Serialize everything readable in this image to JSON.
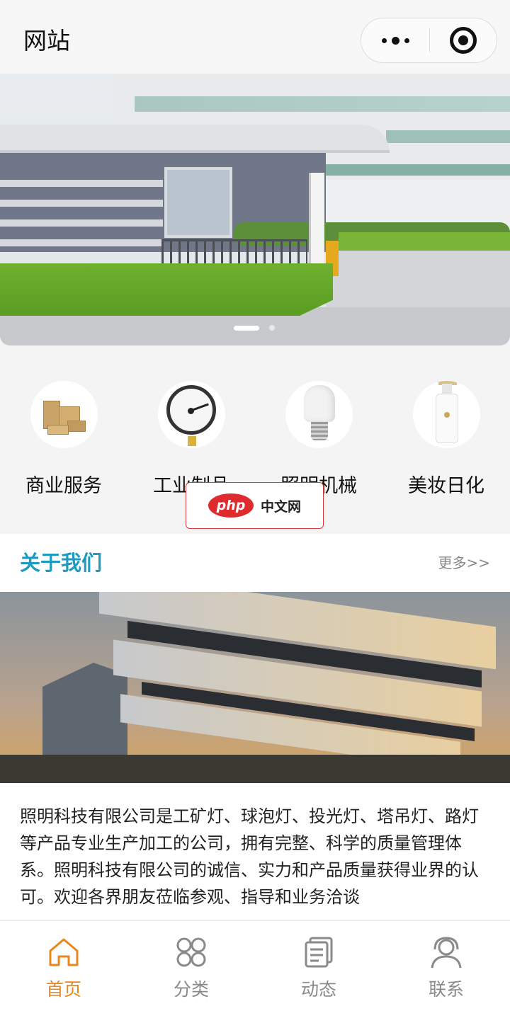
{
  "navbar": {
    "title": "网站"
  },
  "banner": {
    "slides": 2,
    "active_slide": 1
  },
  "categories": [
    {
      "label": "商业服务",
      "icon": "cardboard-boxes-icon"
    },
    {
      "label": "工业制品",
      "icon": "pressure-gauge-icon"
    },
    {
      "label": "照明机械",
      "icon": "light-bulb-icon"
    },
    {
      "label": "美妆日化",
      "icon": "lotion-bottle-icon"
    }
  ],
  "watermark": {
    "logo": "php",
    "text": "中文网"
  },
  "about": {
    "title": "关于我们",
    "more": "更多>>",
    "text": "照明科技有限公司是工矿灯、球泡灯、投光灯、塔吊灯、路灯等产品专业生产加工的公司，拥有完整、科学的质量管理体系。照明科技有限公司的诚信、实力和产品质量获得业界的认可。欢迎各界朋友莅临参观、指导和业务洽谈"
  },
  "tabbar": [
    {
      "label": "首页",
      "icon": "home-icon",
      "active": true
    },
    {
      "label": "分类",
      "icon": "category-grid-icon",
      "active": false
    },
    {
      "label": "动态",
      "icon": "news-document-icon",
      "active": false
    },
    {
      "label": "联系",
      "icon": "contact-person-icon",
      "active": false
    }
  ],
  "colors": {
    "accent": "#1f9bc2",
    "tab_active": "#e8871e",
    "tab_inactive": "#8a8a8a",
    "watermark_red": "#e02b2e"
  }
}
